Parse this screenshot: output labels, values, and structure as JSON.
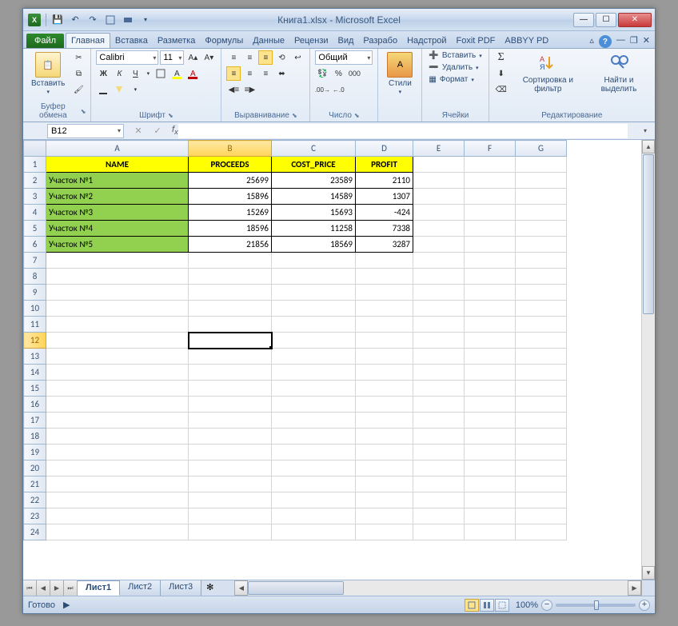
{
  "title": "Книга1.xlsx  -  Microsoft Excel",
  "tabs": {
    "file": "Файл",
    "list": [
      "Главная",
      "Вставка",
      "Разметка",
      "Формулы",
      "Данные",
      "Рецензи",
      "Вид",
      "Разрабо",
      "Надстрой",
      "Foxit PDF",
      "ABBYY PD"
    ],
    "active_index": 0
  },
  "ribbon": {
    "clipboard": {
      "label": "Буфер обмена",
      "paste": "Вставить"
    },
    "font": {
      "label": "Шрифт",
      "name": "Calibri",
      "size": "11",
      "bold": "Ж",
      "italic": "К",
      "underline": "Ч"
    },
    "alignment": {
      "label": "Выравнивание"
    },
    "number": {
      "label": "Число",
      "format": "Общий"
    },
    "styles": {
      "label": "",
      "btn": "Стили"
    },
    "cells": {
      "label": "Ячейки",
      "insert": "Вставить",
      "delete": "Удалить",
      "format": "Формат"
    },
    "editing": {
      "label": "Редактирование",
      "sort": "Сортировка и фильтр",
      "find": "Найти и выделить"
    }
  },
  "namebox": "B12",
  "columns": [
    "A",
    "B",
    "C",
    "D",
    "E",
    "F",
    "G"
  ],
  "headers": [
    "NAME",
    "PROCEEDS",
    "COST_PRICE",
    "PROFIT"
  ],
  "rows": [
    {
      "name": "Участок №1",
      "proceeds": 25699,
      "cost": 23589,
      "profit": 2110
    },
    {
      "name": "Участок №2",
      "proceeds": 15896,
      "cost": 14589,
      "profit": 1307
    },
    {
      "name": "Участок №3",
      "proceeds": 15269,
      "cost": 15693,
      "profit": -424
    },
    {
      "name": "Участок №4",
      "proceeds": 18596,
      "cost": 11258,
      "profit": 7338
    },
    {
      "name": "Участок №5",
      "proceeds": 21856,
      "cost": 18569,
      "profit": 3287
    }
  ],
  "total_rows": 24,
  "active_cell": {
    "row": 12,
    "col": "B"
  },
  "sheets": [
    "Лист1",
    "Лист2",
    "Лист3"
  ],
  "active_sheet": 0,
  "status": {
    "ready": "Готово",
    "zoom": "100%"
  }
}
